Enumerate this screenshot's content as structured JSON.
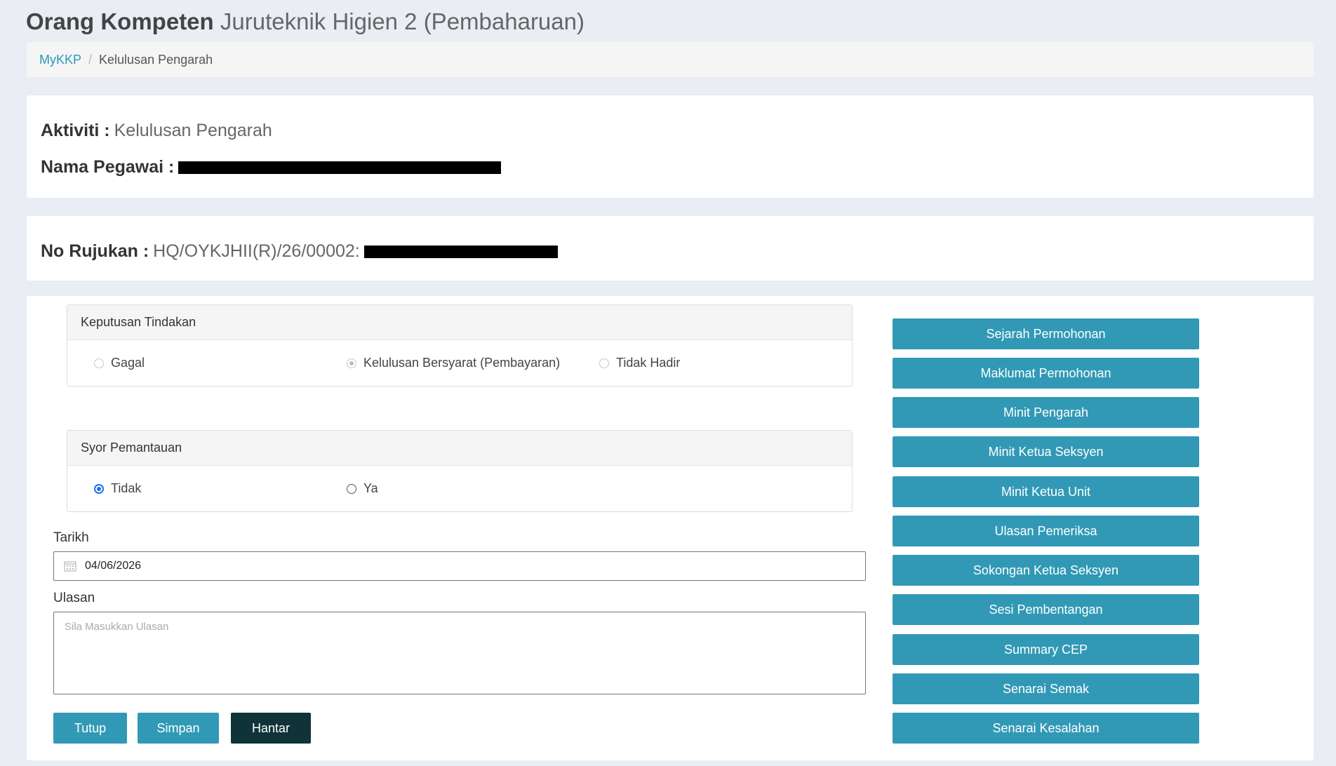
{
  "header": {
    "title_bold": "Orang Kompeten",
    "title_light": "Juruteknik Higien 2 (Pembaharuan)"
  },
  "breadcrumb": {
    "home": "MyKKP",
    "separator": "/",
    "current": "Kelulusan Pengarah"
  },
  "info": {
    "aktiviti_label": "Aktiviti :",
    "aktiviti_value": "Kelulusan Pengarah",
    "nama_label": "Nama Pegawai :",
    "rujukan_label": "No Rujukan :",
    "rujukan_value": "HQ/OYKJHII(R)/26/00002:"
  },
  "keputusan": {
    "title": "Keputusan Tindakan",
    "options": [
      {
        "label": "Gagal",
        "state": "disabled"
      },
      {
        "label": "Kelulusan Bersyarat (Pembayaran)",
        "state": "checked-disabled"
      },
      {
        "label": "Tidak Hadir",
        "state": "disabled"
      }
    ]
  },
  "syor": {
    "title": "Syor Pemantauan",
    "options": [
      {
        "label": "Tidak",
        "state": "checked"
      },
      {
        "label": "Ya",
        "state": "unchecked"
      }
    ]
  },
  "tarikh": {
    "label": "Tarikh",
    "value": "04/06/2026"
  },
  "ulasan": {
    "label": "Ulasan",
    "placeholder": "Sila Masukkan Ulasan"
  },
  "actions": {
    "tutup": "Tutup",
    "simpan": "Simpan",
    "hantar": "Hantar"
  },
  "side_buttons": [
    "Sejarah Permohonan",
    "Maklumat Permohonan",
    "Minit Pengarah",
    "Minit Ketua Seksyen",
    "Minit Ketua Unit",
    "Ulasan Pemeriksa",
    "Sokongan Ketua Seksyen",
    "Sesi Pembentangan",
    "Summary CEP",
    "Senarai Semak",
    "Senarai Kesalahan"
  ],
  "colors": {
    "primary": "#3199b5",
    "dark": "#10333a",
    "background": "#eaedf4",
    "radio_selected": "#1a73e8"
  }
}
